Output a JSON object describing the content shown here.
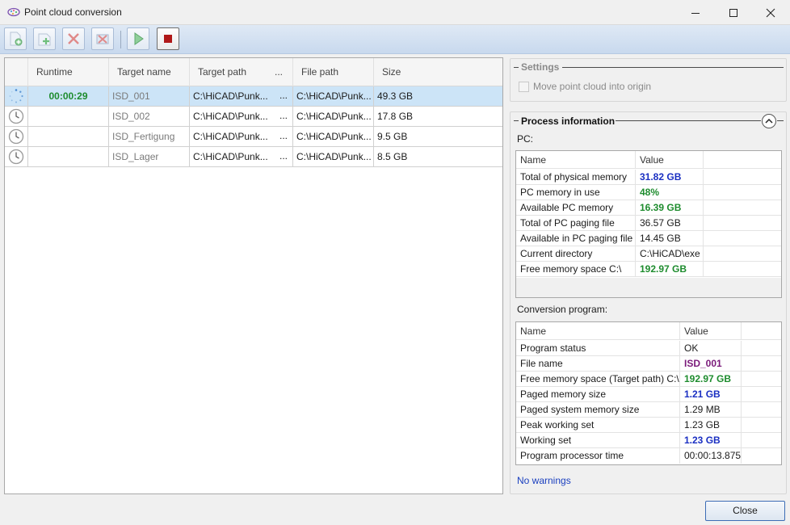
{
  "window": {
    "title": "Point cloud conversion"
  },
  "toolbar": {
    "buttons": [
      {
        "name": "add-file-icon"
      },
      {
        "name": "add-folder-icon"
      },
      {
        "name": "delete-icon"
      },
      {
        "name": "delete-all-icon"
      },
      {
        "name": "play-icon"
      },
      {
        "name": "stop-icon"
      }
    ]
  },
  "grid": {
    "columns": [
      "",
      "Runtime",
      "Target name",
      "Target path",
      "File path",
      "Size"
    ],
    "ellipsis": "...",
    "rows": [
      {
        "status": "running",
        "runtime": "00:00:29",
        "target_name": "ISD_001",
        "target_path": "C:\\HiCAD\\Punk...",
        "file_path": "C:\\HiCAD\\Punk...",
        "size": "49.3 GB"
      },
      {
        "status": "waiting",
        "runtime": "",
        "target_name": "ISD_002",
        "target_path": "C:\\HiCAD\\Punk...",
        "file_path": "C:\\HiCAD\\Punk...",
        "size": "17.8 GB"
      },
      {
        "status": "waiting",
        "runtime": "",
        "target_name": "ISD_Fertigung",
        "target_path": "C:\\HiCAD\\Punk...",
        "file_path": "C:\\HiCAD\\Punk...",
        "size": "9.5 GB"
      },
      {
        "status": "waiting",
        "runtime": "",
        "target_name": "ISD_Lager",
        "target_path": "C:\\HiCAD\\Punk...",
        "file_path": "C:\\HiCAD\\Punk...",
        "size": "8.5 GB"
      }
    ]
  },
  "settings": {
    "title": "Settings",
    "move_origin_label": "Move point cloud into origin",
    "move_origin_checked": false
  },
  "process": {
    "title": "Process information",
    "pc_label": "PC:",
    "pc_table": {
      "headers": [
        "Name",
        "Value"
      ],
      "rows": [
        {
          "name": "Total of physical memory",
          "value": "31.82 GB",
          "style": "blue"
        },
        {
          "name": "PC memory in use",
          "value": "48%",
          "style": "green"
        },
        {
          "name": "Available PC memory",
          "value": "16.39 GB",
          "style": "green"
        },
        {
          "name": "Total of PC paging file",
          "value": "36.57 GB",
          "style": "normal"
        },
        {
          "name": "Available in PC paging file",
          "value": "14.45 GB",
          "style": "normal"
        },
        {
          "name": "Current directory",
          "value": "C:\\HiCAD\\exe",
          "style": "normal"
        },
        {
          "name": "Free memory space C:\\",
          "value": "192.97 GB",
          "style": "green"
        }
      ]
    },
    "conversion_label": "Conversion program:",
    "conversion_table": {
      "headers": [
        "Name",
        "Value"
      ],
      "rows": [
        {
          "name": "Program status",
          "value": "OK",
          "style": "normal"
        },
        {
          "name": "File name",
          "value": "ISD_001",
          "style": "purple"
        },
        {
          "name": "Free memory space (Target path) C:\\",
          "value": "192.97 GB",
          "style": "green"
        },
        {
          "name": "Paged memory size",
          "value": "1.21 GB",
          "style": "blue"
        },
        {
          "name": "Paged system memory size",
          "value": "1.29 MB",
          "style": "normal"
        },
        {
          "name": "Peak working set",
          "value": "1.23 GB",
          "style": "normal"
        },
        {
          "name": "Working set",
          "value": "1.23 GB",
          "style": "blue"
        },
        {
          "name": "Program processor time",
          "value": "00:00:13.875",
          "style": "normal"
        }
      ]
    },
    "warnings": "No warnings"
  },
  "footer": {
    "close_label": "Close"
  },
  "colors": {
    "blue": "#1a2fc2",
    "green": "#1e8c2e",
    "purple": "#7a1a7a",
    "link": "#1a3fbf"
  }
}
